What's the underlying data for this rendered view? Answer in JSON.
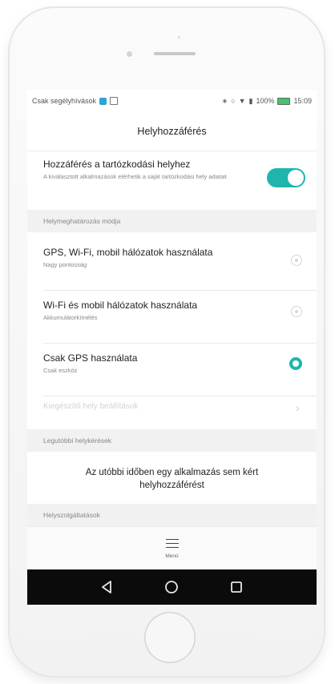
{
  "status_bar": {
    "carrier": "Csak segélyhívások",
    "battery": "100%",
    "time": "15:09"
  },
  "header": {
    "title": "Helyhozzáférés"
  },
  "location_access": {
    "title": "Hozzáférés a tartózkodási helyhez",
    "subtitle": "A kiválasztott alkalmazások elérhetik a saját tartózkodási hely adatait",
    "enabled": true
  },
  "mode_section": {
    "label": "Helymeghatározás módja",
    "options": [
      {
        "title": "GPS, Wi-Fi, mobil hálózatok használata",
        "subtitle": "Nagy pontosság",
        "selected": false
      },
      {
        "title": "Wi-Fi és mobil hálózatok használata",
        "subtitle": "Akkumulátorkímélés",
        "selected": false
      },
      {
        "title": "Csak GPS használata",
        "subtitle": "Csak eszköz",
        "selected": true
      }
    ]
  },
  "advanced": {
    "label": "Kiegészítő hely beállítások"
  },
  "recent_section": {
    "label": "Legutóbbi helykérések",
    "empty_message": "Az utóbbi időben egy alkalmazás sem kért helyhozzáférést"
  },
  "services_section": {
    "label": "Helyszolgáltatások"
  },
  "bottom_menu": {
    "label": "Menü",
    "icon": "menu-icon"
  },
  "colors": {
    "accent": "#1fb5ad",
    "navbar": "#0b0b0b"
  }
}
